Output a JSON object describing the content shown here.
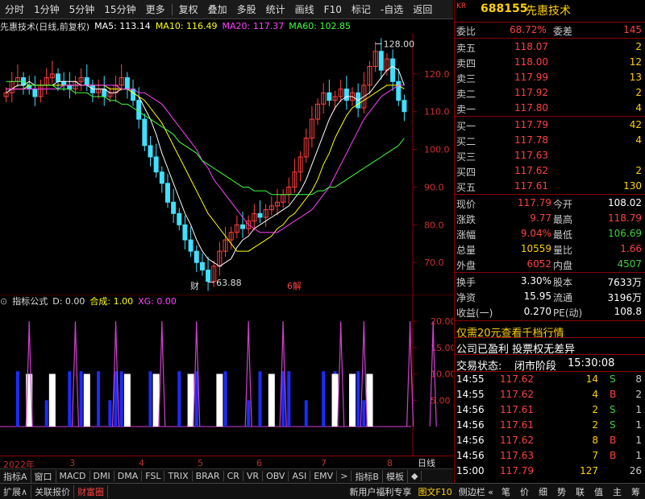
{
  "toolbar": {
    "items": [
      "分时",
      "1分钟",
      "5分钟",
      "15分钟",
      "更多",
      "复权",
      "叠加",
      "多股",
      "统计",
      "画线",
      "F10",
      "标记",
      "-自选",
      "返回"
    ]
  },
  "stock": {
    "code": "688155",
    "name": "先惠技术",
    "badge": "KR",
    "title": "先惠技术(日线,前复权)"
  },
  "ma_legend": [
    {
      "label": "MA5: 113.14",
      "color": "#ffffff"
    },
    {
      "label": "MA10: 116.49",
      "color": "#ffff00"
    },
    {
      "label": "MA20: 117.37",
      "color": "#ff40ff"
    },
    {
      "label": "MA60: 102.85",
      "color": "#40ff40"
    }
  ],
  "indicator_legend": {
    "name": "指标公式",
    "d": "D: 0.00",
    "hecheng": "合成: 1.00",
    "xg": "XG: 0.00"
  },
  "chart_data": [
    {
      "type": "candlestick",
      "title": "先惠技术(日线,前复权)",
      "ylim": [
        63,
        130
      ],
      "yticks": [
        "120.0",
        "110.0",
        "100.0",
        "90.0",
        "80.0",
        "70.0"
      ],
      "x_labels": [
        "2022年",
        "3",
        "4",
        "5",
        "6",
        "7",
        "8"
      ],
      "annotations": {
        "high": "128.00",
        "low": "63.88",
        "markers": [
          "财",
          "6解"
        ]
      },
      "close": [
        115,
        118,
        119,
        117,
        116,
        114,
        117,
        119,
        120,
        118,
        117,
        116,
        118,
        119,
        117,
        115,
        116,
        114,
        115,
        117,
        119,
        116,
        113,
        108,
        101,
        98,
        94,
        91,
        86,
        83,
        80,
        76,
        73,
        70,
        68,
        65,
        69,
        73,
        76,
        78,
        80,
        79,
        81,
        83,
        82,
        84,
        85,
        86,
        88,
        90,
        94,
        98,
        103,
        108,
        112,
        115,
        113,
        114,
        116,
        113,
        115,
        111,
        117,
        122,
        126,
        121,
        124,
        118,
        113,
        110
      ],
      "series": [
        {
          "name": "MA5",
          "color": "#ffffff",
          "values": [
            115,
            116,
            117,
            117,
            118,
            117,
            117,
            117,
            117,
            118,
            118,
            118,
            118,
            117,
            117,
            116,
            116,
            116,
            115,
            115,
            116,
            116,
            115,
            114,
            111,
            108,
            104,
            99,
            95,
            91,
            87,
            83,
            80,
            76,
            73,
            71,
            70,
            69,
            70,
            71,
            74,
            76,
            77,
            79,
            80,
            81,
            82,
            83,
            84,
            85,
            87,
            89,
            92,
            96,
            100,
            104,
            108,
            111,
            113,
            114,
            114,
            113,
            114,
            115,
            117,
            119,
            121,
            122,
            121,
            117
          ]
        },
        {
          "name": "MA10",
          "color": "#ffff00",
          "values": [
            116,
            116,
            116,
            116,
            117,
            117,
            117,
            117,
            117,
            117,
            117,
            117,
            117,
            117,
            117,
            117,
            117,
            117,
            116,
            116,
            116,
            116,
            115,
            114,
            113,
            111,
            109,
            107,
            104,
            101,
            98,
            95,
            92,
            89,
            86,
            83,
            81,
            79,
            77,
            75,
            73,
            73,
            73,
            74,
            75,
            76,
            77,
            79,
            80,
            82,
            83,
            85,
            87,
            89,
            92,
            96,
            99,
            103,
            106,
            109,
            111,
            112,
            113,
            114,
            115,
            116,
            117,
            117,
            117,
            116
          ]
        },
        {
          "name": "MA20",
          "color": "#ff40ff",
          "values": [
            116,
            116,
            116,
            116,
            116,
            116,
            116,
            116,
            116,
            116,
            117,
            117,
            117,
            117,
            117,
            117,
            117,
            117,
            117,
            117,
            116,
            116,
            116,
            115,
            115,
            114,
            113,
            112,
            110,
            108,
            106,
            104,
            102,
            100,
            97,
            95,
            92,
            90,
            88,
            86,
            84,
            82,
            80,
            79,
            78,
            78,
            78,
            78,
            79,
            80,
            81,
            82,
            83,
            84,
            86,
            88,
            90,
            93,
            96,
            99,
            102,
            105,
            108,
            110,
            112,
            114,
            115,
            116,
            117,
            117
          ]
        },
        {
          "name": "MA60",
          "color": "#40ff40",
          "values": [
            118,
            118,
            118,
            118,
            117,
            117,
            117,
            117,
            117,
            116,
            116,
            116,
            115,
            115,
            115,
            114,
            114,
            114,
            113,
            113,
            112,
            112,
            111,
            110,
            109,
            108,
            107,
            106,
            105,
            104,
            102,
            101,
            100,
            99,
            97,
            96,
            95,
            94,
            93,
            92,
            91,
            90,
            90,
            89,
            89,
            89,
            88,
            88,
            88,
            88,
            88,
            88,
            88,
            88,
            89,
            89,
            90,
            90,
            91,
            92,
            93,
            94,
            95,
            96,
            97,
            98,
            99,
            100,
            101,
            103
          ]
        }
      ]
    },
    {
      "type": "bar",
      "title": "指标公式",
      "ylim": [
        0,
        22
      ],
      "yticks": [
        "20.00",
        "15.00",
        "10.00",
        "5.00"
      ],
      "spikes": [
        4,
        12,
        19,
        27,
        33,
        42,
        48,
        58,
        62,
        70,
        74
      ],
      "blue_bars": [
        2,
        7,
        11,
        13,
        16,
        18,
        19,
        20,
        25,
        26,
        30,
        33,
        38,
        42,
        44,
        48,
        49,
        52,
        55,
        57,
        61,
        62
      ],
      "white_bars": [
        4,
        8,
        14,
        21,
        26,
        32,
        37,
        46,
        57,
        60,
        63
      ]
    }
  ],
  "quote": {
    "weibi_label": "委比",
    "weibi": "68.72%",
    "weicha_label": "委差",
    "weicha": "145",
    "asks": [
      {
        "label": "卖五",
        "price": "118.07",
        "vol": "2"
      },
      {
        "label": "卖四",
        "price": "118.00",
        "vol": "12"
      },
      {
        "label": "卖三",
        "price": "117.99",
        "vol": "13"
      },
      {
        "label": "卖二",
        "price": "117.92",
        "vol": "2"
      },
      {
        "label": "卖一",
        "price": "117.80",
        "vol": "4"
      }
    ],
    "bids": [
      {
        "label": "买一",
        "price": "117.79",
        "vol": "42"
      },
      {
        "label": "买二",
        "price": "117.78",
        "vol": "4"
      },
      {
        "label": "买三",
        "price": "117.63",
        "vol": ""
      },
      {
        "label": "买四",
        "price": "117.62",
        "vol": "2"
      },
      {
        "label": "买五",
        "price": "117.61",
        "vol": "130"
      }
    ],
    "stats": [
      {
        "l1": "现价",
        "v1": "117.79",
        "c1": "up",
        "l2": "今开",
        "v2": "108.02",
        "c2": "wt"
      },
      {
        "l1": "涨跌",
        "v1": "9.77",
        "c1": "up",
        "l2": "最高",
        "v2": "118.79",
        "c2": "up"
      },
      {
        "l1": "涨幅",
        "v1": "9.04%",
        "c1": "up",
        "l2": "最低",
        "v2": "106.69",
        "c2": "dn"
      },
      {
        "l1": "总量",
        "v1": "10559",
        "c1": "yl",
        "l2": "量比",
        "v2": "1.66",
        "c2": "up"
      },
      {
        "l1": "外盘",
        "v1": "6052",
        "c1": "up",
        "l2": "内盘",
        "v2": "4507",
        "c2": "dn"
      }
    ],
    "stats2": [
      {
        "l1": "换手",
        "v1": "3.30%",
        "l2": "股本",
        "v2": "7633万"
      },
      {
        "l1": "净资",
        "v1": "15.95",
        "l2": "流通",
        "v2": "3196万"
      },
      {
        "l1": "收益(一)",
        "v1": "0.270",
        "l2": "PE(动)",
        "v2": "108.8"
      }
    ],
    "promo": "仅需20元查看千档行情",
    "note": "公司已盈利 投票权无差异",
    "status_label": "交易状态:",
    "status": "闭市阶段",
    "status_time": "15:30:08"
  },
  "ticks": [
    {
      "time": "14:55",
      "price": "117.62",
      "vol": "14",
      "side": "S",
      "num": "8"
    },
    {
      "time": "14:55",
      "price": "117.62",
      "vol": "4",
      "side": "B",
      "num": "2"
    },
    {
      "time": "14:56",
      "price": "117.61",
      "vol": "2",
      "side": "S",
      "num": "1"
    },
    {
      "time": "14:56",
      "price": "117.61",
      "vol": "2",
      "side": "S",
      "num": "1"
    },
    {
      "time": "14:56",
      "price": "117.62",
      "vol": "8",
      "side": "B",
      "num": "1"
    },
    {
      "time": "14:56",
      "price": "117.63",
      "vol": "7",
      "side": "B",
      "num": "1"
    },
    {
      "time": "15:00",
      "price": "117.79",
      "vol": "127",
      "side": "",
      "num": "26"
    }
  ],
  "indicator_tabs": [
    "指标A",
    "窗口",
    "MACD",
    "DMI",
    "DMA",
    "FSL",
    "TRIX",
    "BRAR",
    "CR",
    "VR",
    "OBV",
    "ASI",
    "EMV",
    ">",
    "指标B",
    "模板",
    "◆"
  ],
  "bottom": {
    "left": [
      "扩展∧",
      "关联报价",
      "财富圈"
    ],
    "right": [
      "新用户福利专享",
      "图文F10",
      "侧边栏 «"
    ],
    "tools": [
      "笔",
      "价",
      "细",
      "势",
      "联",
      "值",
      "主",
      "筹"
    ]
  },
  "daily_label": "日线",
  "colors": {
    "up": "#ff4040",
    "down": "#40d040",
    "axis": "#8b0000",
    "blue": "#1c2cff",
    "spike": "#d040d0"
  }
}
